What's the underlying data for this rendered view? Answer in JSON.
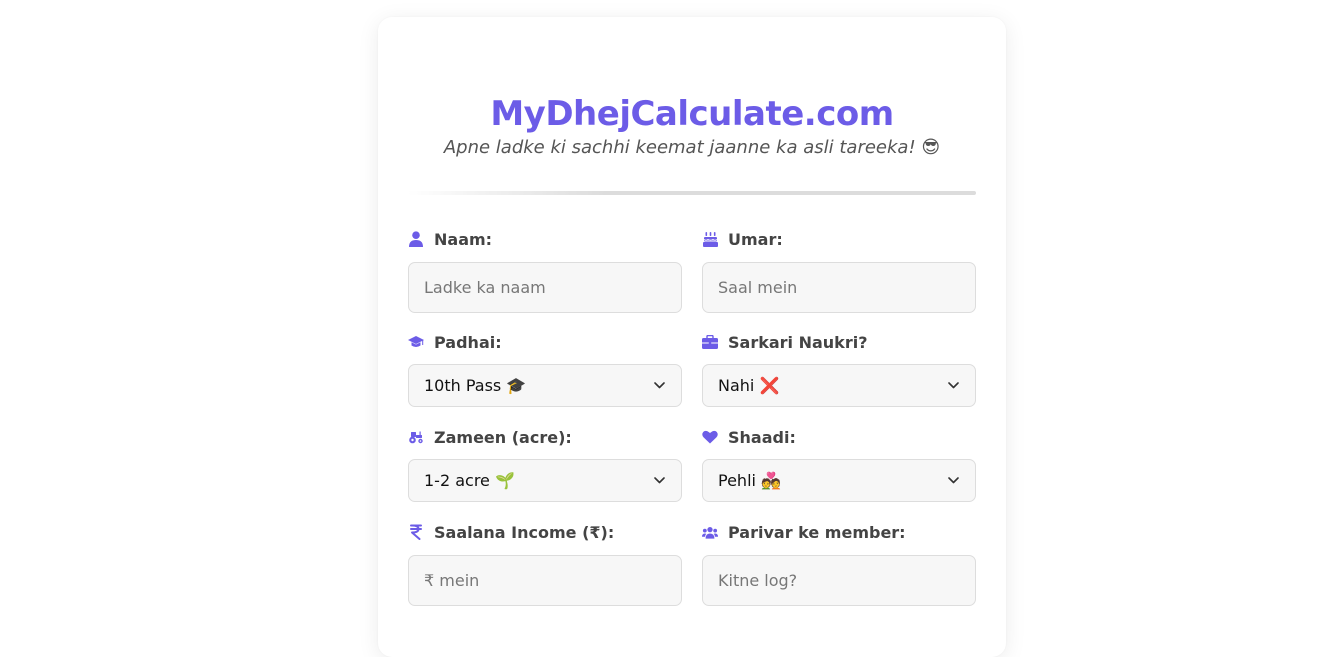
{
  "header": {
    "title": "MyDhejCalculate.com",
    "subtitle": "Apne ladke ki sachhi keemat jaanne ka asli tareeka! 😎"
  },
  "colors": {
    "accent": "#6c5ce7",
    "label_text": "#444444",
    "input_bg": "#f7f7f7",
    "input_border": "#dddddd"
  },
  "form": {
    "naam": {
      "label": "Naam:",
      "icon": "user-icon",
      "placeholder": "Ladke ka naam",
      "value": ""
    },
    "umar": {
      "label": "Umar:",
      "icon": "birthday-cake-icon",
      "placeholder": "Saal mein",
      "value": ""
    },
    "padhai": {
      "label": "Padhai:",
      "icon": "graduation-cap-icon",
      "selected": "10th Pass 🎓"
    },
    "sarkari_naukri": {
      "label": "Sarkari Naukri?",
      "icon": "briefcase-icon",
      "selected": "Nahi ❌"
    },
    "zameen": {
      "label": "Zameen (acre):",
      "icon": "tractor-icon",
      "selected": "1-2 acre 🌱"
    },
    "shaadi": {
      "label": "Shaadi:",
      "icon": "heart-icon",
      "selected": "Pehli 💑"
    },
    "income": {
      "label": "Saalana Income (₹):",
      "icon": "rupee-icon",
      "placeholder": "₹ mein",
      "value": ""
    },
    "parivar": {
      "label": "Parivar ke member:",
      "icon": "users-icon",
      "placeholder": "Kitne log?",
      "value": ""
    }
  }
}
